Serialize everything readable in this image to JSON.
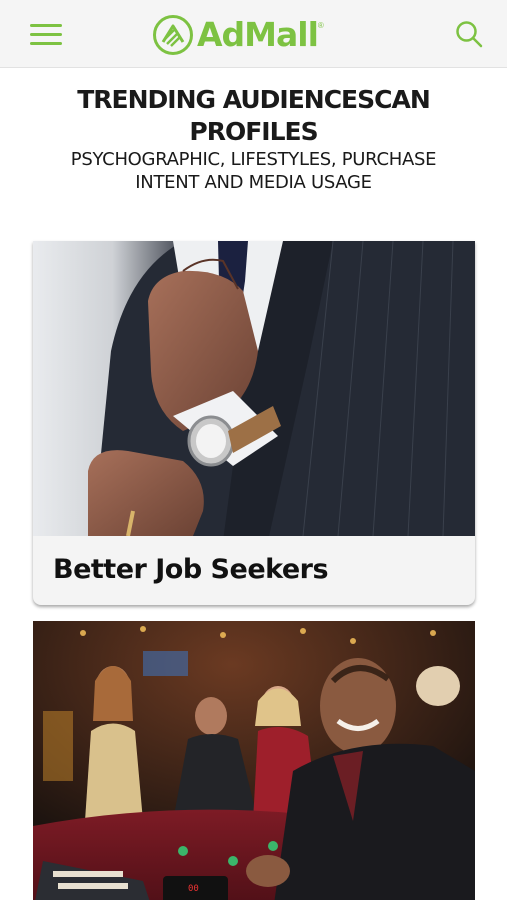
{
  "header": {
    "brand": "AdMall",
    "registered_mark": "®",
    "accent_color": "#7dc242",
    "menu_icon": "hamburger-icon",
    "search_icon": "search-icon"
  },
  "section": {
    "title": "TRENDING AUDIENCESCAN PROFILES",
    "subtitle": "PSYCHOGRAPHIC, LIFESTYLES, PURCHASE INTENT AND MEDIA USAGE"
  },
  "cards": [
    {
      "title": "Better Job Seekers"
    },
    {
      "title": ""
    }
  ]
}
